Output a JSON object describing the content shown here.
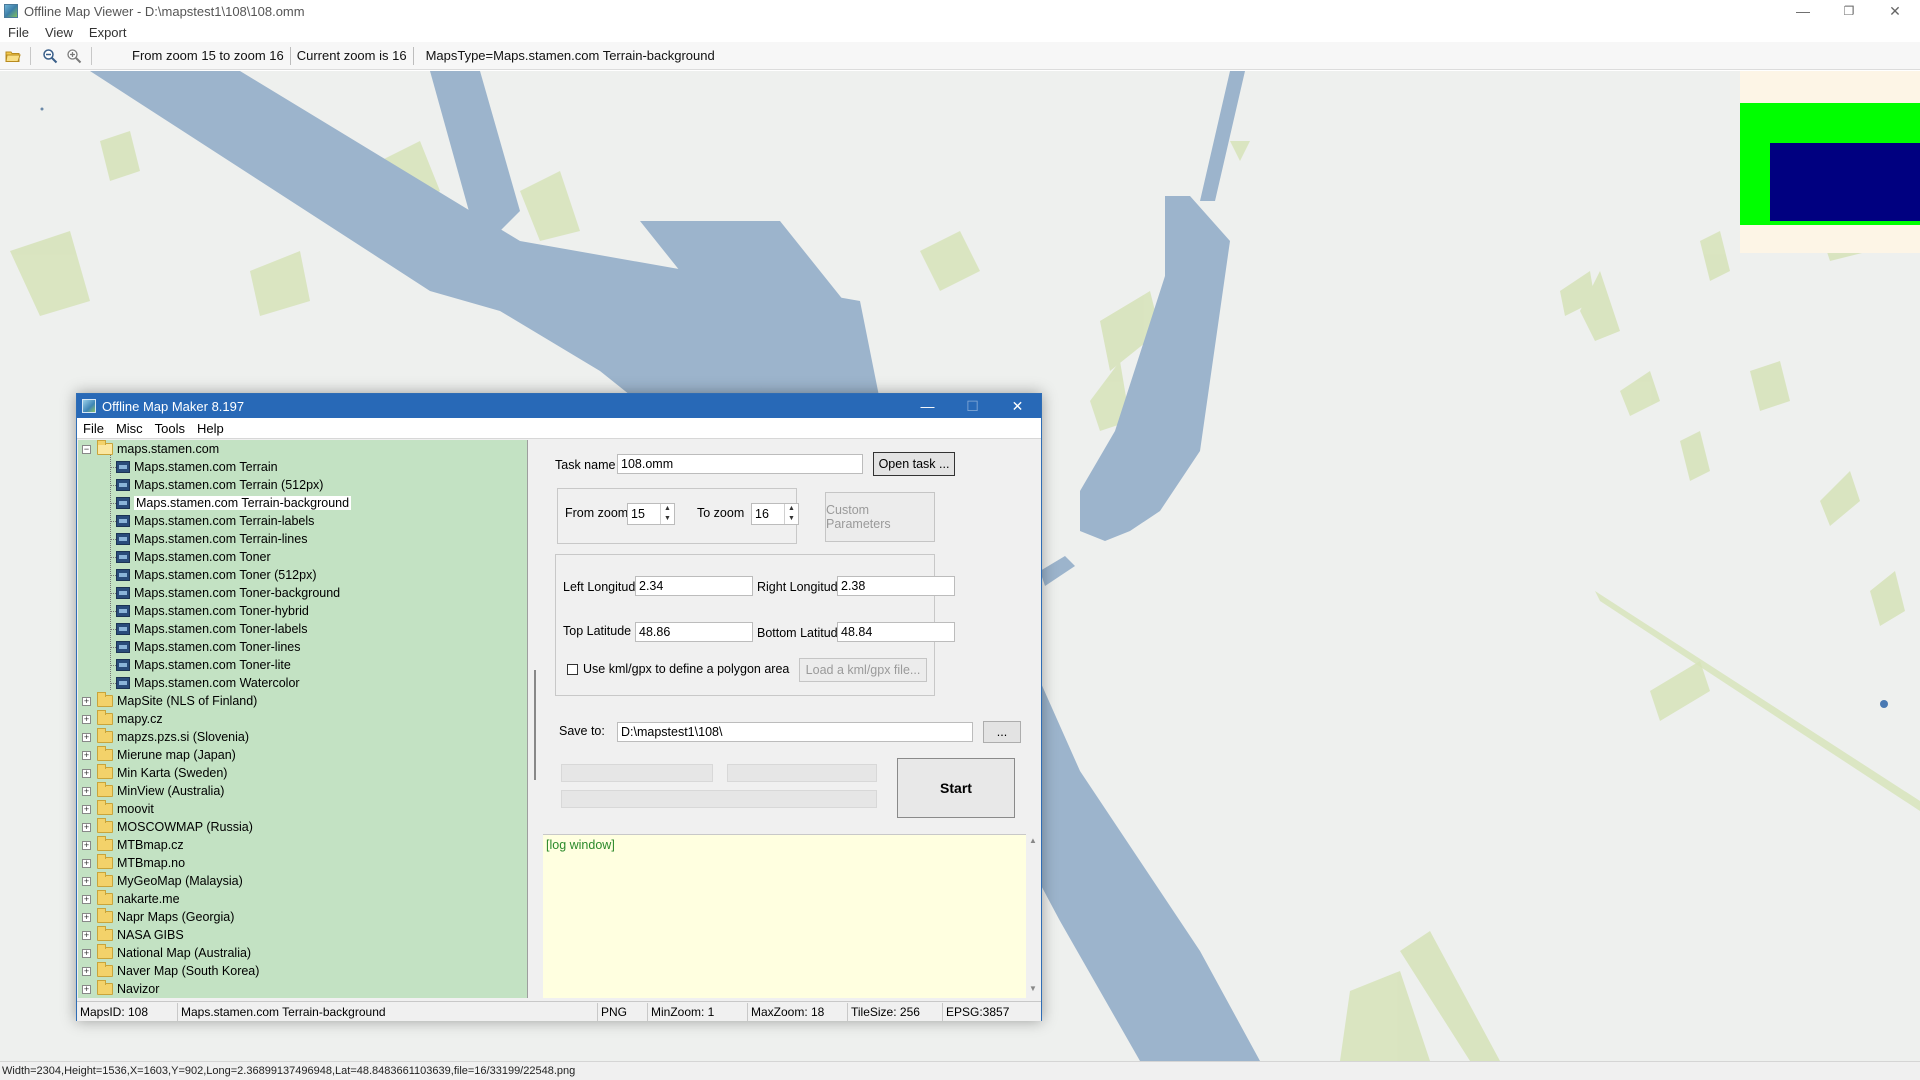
{
  "viewer": {
    "title": "Offline Map Viewer - D:\\mapstest1\\108\\108.omm",
    "menu": [
      "File",
      "View",
      "Export"
    ],
    "toolbar": {
      "zoom_range": "From zoom 15 to zoom 16",
      "current_zoom": "Current zoom is 16",
      "maps_type": "MapsType=Maps.stamen.com Terrain-background"
    },
    "status": "Width=2304,Height=1536,X=1603,Y=902,Long=2.36899137496948,Lat=48.8483661103639,file=16/33199/22548.png",
    "colors": {
      "water": "#9cb4cc",
      "land": "#eef0ee",
      "park": "#d6e3b8",
      "minimap_green": "#00ff00",
      "minimap_navy": "#000080"
    }
  },
  "dialog": {
    "title": "Offline Map Maker 8.197",
    "menu": [
      "File",
      "Misc",
      "Tools",
      "Help"
    ],
    "tree": {
      "root": "maps.stamen.com",
      "children": [
        "Maps.stamen.com Terrain",
        "Maps.stamen.com Terrain (512px)",
        "Maps.stamen.com Terrain-background",
        "Maps.stamen.com Terrain-labels",
        "Maps.stamen.com Terrain-lines",
        "Maps.stamen.com Toner",
        "Maps.stamen.com Toner (512px)",
        "Maps.stamen.com Toner-background",
        "Maps.stamen.com Toner-hybrid",
        "Maps.stamen.com Toner-labels",
        "Maps.stamen.com Toner-lines",
        "Maps.stamen.com Toner-lite",
        "Maps.stamen.com Watercolor"
      ],
      "selected_index": 2,
      "folders": [
        "MapSite (NLS of Finland)",
        "mapy.cz",
        "mapzs.pzs.si (Slovenia)",
        "Mierune map (Japan)",
        "Min Karta (Sweden)",
        "MinView (Australia)",
        "moovit",
        "MOSCOWMAP (Russia)",
        "MTBmap.cz",
        "MTBmap.no",
        "MyGeoMap (Malaysia)",
        "nakarte.me",
        "Napr Maps (Georgia)",
        "NASA GIBS",
        "National Map (Australia)",
        "Naver Map (South Korea)",
        "Navizor"
      ]
    },
    "form": {
      "task_name_label": "Task name",
      "task_name_value": "108.omm",
      "open_task": "Open task ...",
      "from_zoom_label": "From zoom",
      "from_zoom_value": "15",
      "to_zoom_label": "To zoom",
      "to_zoom_value": "16",
      "custom_params": "Custom Parameters",
      "left_lon_label": "Left Longitude",
      "left_lon_value": "2.34",
      "right_lon_label": "Right Longitude",
      "right_lon_value": "2.38",
      "top_lat_label": "Top Latitude",
      "top_lat_value": "48.86",
      "bottom_lat_label": "Bottom Latitude",
      "bottom_lat_value": "48.84",
      "kml_checkbox_label": "Use kml/gpx to define a polygon area",
      "load_kml": "Load a kml/gpx file...",
      "save_to_label": "Save to:",
      "save_to_value": "D:\\mapstest1\\108\\",
      "browse": "...",
      "start": "Start",
      "log": "[log window]"
    },
    "status": {
      "maps_id": "MapsID: 108",
      "maps_name": "Maps.stamen.com Terrain-background",
      "format": "PNG",
      "min_zoom": "MinZoom: 1",
      "max_zoom": "MaxZoom: 18",
      "tile_size": "TileSize: 256",
      "epsg": "EPSG:3857"
    }
  }
}
